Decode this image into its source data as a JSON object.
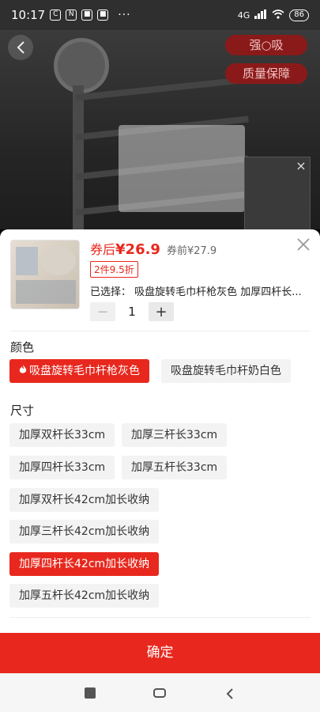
{
  "status": {
    "time": "10:17",
    "battery": "86",
    "dots": "···",
    "left_icons": [
      "C",
      "N",
      "■",
      "■"
    ],
    "right_indicators": "4G"
  },
  "hero": {
    "badges": [
      "强○吸",
      "质量保障"
    ]
  },
  "product": {
    "coupon_price_label": "券后",
    "coupon_price": "¥26.9",
    "original_price": "券前¥27.9",
    "promo_tag": "2件9.5折",
    "selected_text": "已选择：  吸盘旋转毛巾杆枪灰色 加厚四杆长...",
    "quantity": "1",
    "minus_label": "−",
    "plus_label": "+"
  },
  "color": {
    "title": "颜色",
    "options": [
      "吸盘旋转毛巾杆枪灰色",
      "吸盘旋转毛巾杆奶白色"
    ],
    "selected_index": 0
  },
  "size": {
    "title": "尺寸",
    "options": [
      "加厚双杆长33cm",
      "加厚三杆长33cm",
      "加厚四杆长33cm",
      "加厚五杆长33cm",
      "加厚双杆长42cm加长收纳",
      "加厚三杆长42cm加长收纳",
      "加厚四杆长42cm加长收纳",
      "加厚五杆长42cm加长收纳"
    ],
    "selected_index": 6
  },
  "confirm_label": "确定",
  "colors": {
    "accent": "#e8281e",
    "chip_bg": "#f3f3f3"
  }
}
